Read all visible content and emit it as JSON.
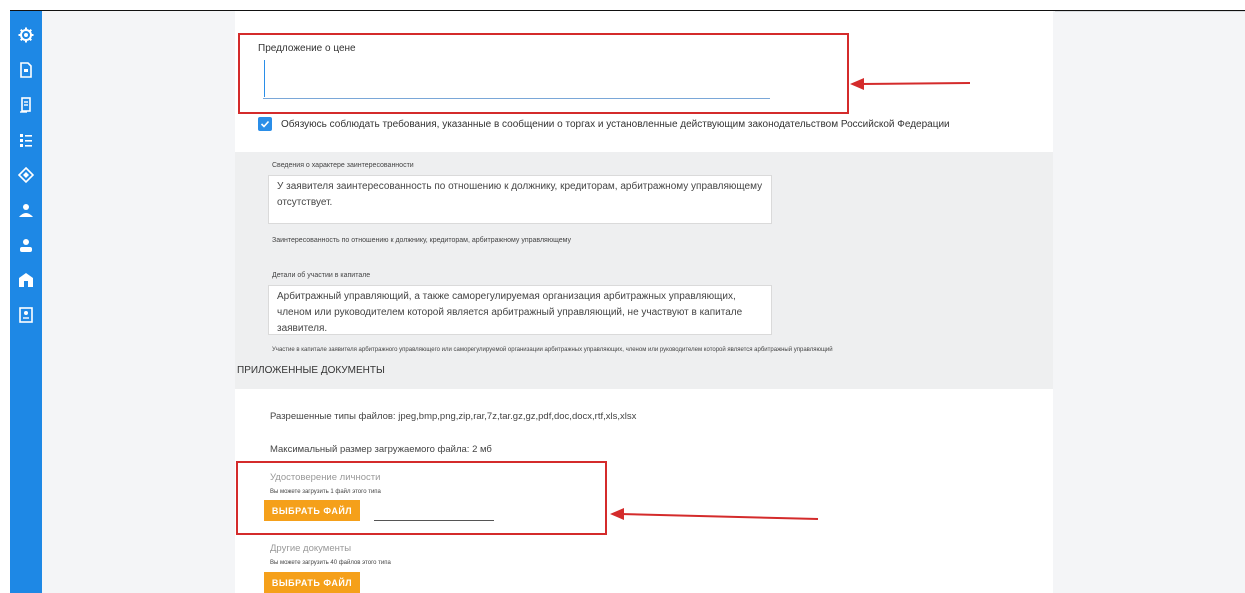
{
  "price_offer": {
    "label": "Предложение о цене",
    "value": ""
  },
  "agreement": {
    "checked": true,
    "text": "Обязуюсь соблюдать требования, указанные в сообщении о торгах и установленные действующим законодательством Российской Федерации"
  },
  "interest": {
    "label": "Сведения о характере заинтересованности",
    "text": "У заявителя заинтересованность по отношению к должнику, кредиторам, арбитражному управляющему отсутствует.",
    "hint": "Заинтересованность по отношению к должнику, кредиторам, арбитражному управляющему"
  },
  "capital": {
    "label": "Детали об участии в капитале",
    "text": "Арбитражный управляющий, а также саморегулируемая организация арбитражных управляющих, членом или руководителем которой является арбитражный управляющий, не участвуют в капитале заявителя.",
    "hint": "Участие в капитале заявителя арбитражного управляющего или саморегулируемой организации арбитражных управляющих, членом или руководителем которой является арбитражный управляющий"
  },
  "documents": {
    "title": "ПРИЛОЖЕННЫЕ ДОКУМЕНТЫ",
    "allowed_types": "Разрешенные типы файлов: jpeg,bmp,png,zip,rar,7z,tar.gz,gz,pdf,doc,docx,rtf,xls,xlsx",
    "max_size": "Максимальный размер загружаемого файла: 2 мб",
    "identity": {
      "title": "Удостоверение личности",
      "note": "Вы можете загрузить 1 файл этого типа",
      "button": "ВЫБРАТЬ ФАЙЛ"
    },
    "other": {
      "title": "Другие документы",
      "note": "Вы можете загрузить 40 файлов этого типа",
      "button": "ВЫБРАТЬ ФАЙЛ"
    }
  },
  "sidebar_icons": [
    "settings-icon",
    "document-icon",
    "tender-icon",
    "list-icon",
    "auction-icon",
    "bidder-icon",
    "user-icon",
    "bank-icon",
    "contract-icon"
  ],
  "colors": {
    "sidebar": "#1e88e5",
    "accent_blue": "#2a8ee8",
    "button_orange": "#f5a01a",
    "annotation_red": "#d42b2b"
  }
}
